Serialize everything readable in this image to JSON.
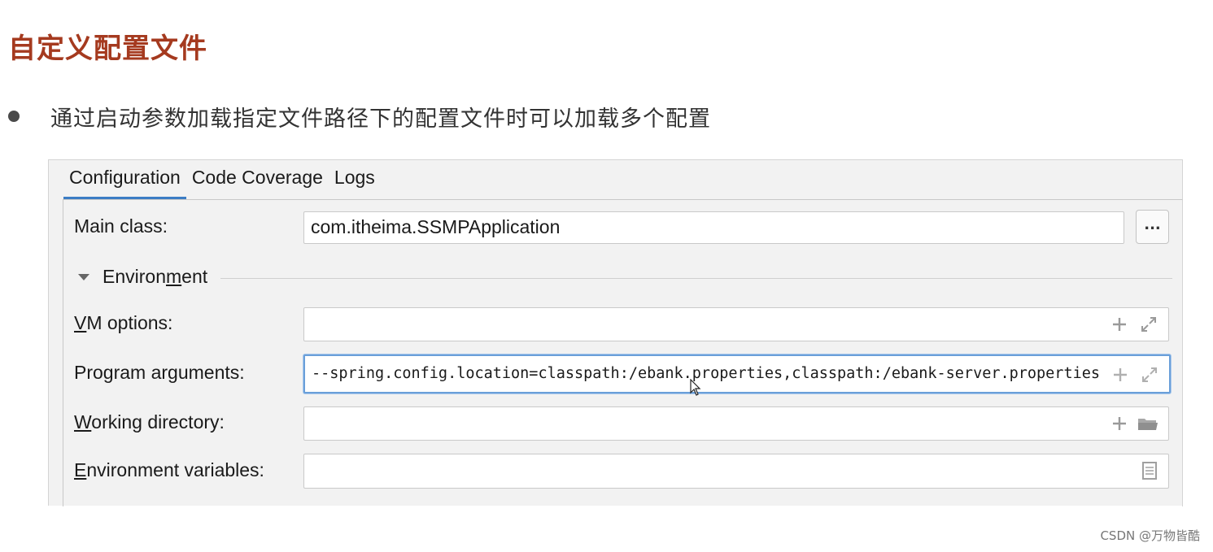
{
  "slide": {
    "title": "自定义配置文件",
    "bullet": "通过启动参数加载指定文件路径下的配置文件时可以加载多个配置"
  },
  "tabs": [
    {
      "label": "Configuration",
      "active": true
    },
    {
      "label": "Code Coverage",
      "active": false
    },
    {
      "label": "Logs",
      "active": false
    }
  ],
  "main_class": {
    "label": "Main class:",
    "value": "com.itheima.SSMPApplication",
    "browse_label": "..."
  },
  "environment_section": {
    "label_before": "Environ",
    "label_underlined": "m",
    "label_after": "ent"
  },
  "vm_options": {
    "label_underlined": "V",
    "label_rest": "M options:",
    "value": ""
  },
  "program_arguments": {
    "label_before": "Program ar",
    "label_underlined": "g",
    "label_after": "uments:",
    "value": "--spring.config.location=classpath:/ebank.properties,classpath:/ebank-server.properties"
  },
  "working_directory": {
    "label_underlined": "W",
    "label_rest": "orking directory:",
    "value": ""
  },
  "environment_variables": {
    "label_underlined": "E",
    "label_rest": "nvironment variables:",
    "value": ""
  },
  "watermark": "CSDN @万物皆酷",
  "colors": {
    "title": "#a53a1f",
    "tab_underline": "#3c7dc4",
    "focus_border": "#6a9fd9",
    "icon_gray": "#9a9a9a"
  }
}
